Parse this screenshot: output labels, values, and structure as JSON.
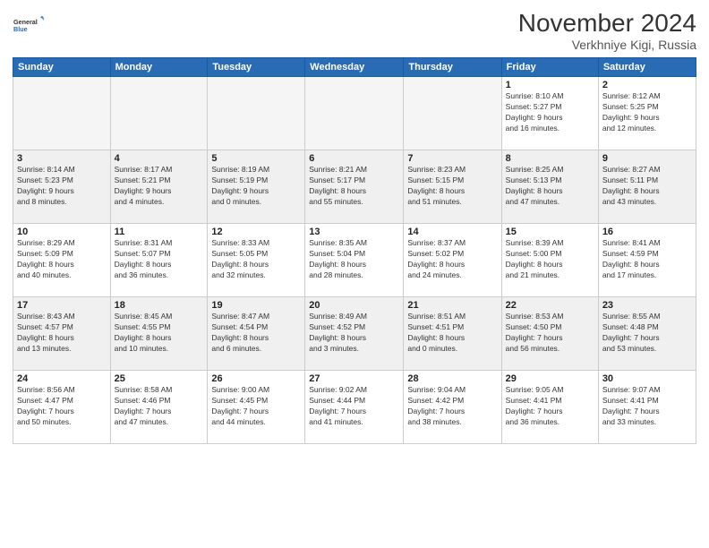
{
  "header": {
    "logo": {
      "general": "General",
      "blue": "Blue"
    },
    "title": "November 2024",
    "location": "Verkhniye Kigi, Russia"
  },
  "calendar": {
    "days_of_week": [
      "Sunday",
      "Monday",
      "Tuesday",
      "Wednesday",
      "Thursday",
      "Friday",
      "Saturday"
    ],
    "weeks": [
      [
        {
          "day": "",
          "info": ""
        },
        {
          "day": "",
          "info": ""
        },
        {
          "day": "",
          "info": ""
        },
        {
          "day": "",
          "info": ""
        },
        {
          "day": "",
          "info": ""
        },
        {
          "day": "1",
          "info": "Sunrise: 8:10 AM\nSunset: 5:27 PM\nDaylight: 9 hours\nand 16 minutes."
        },
        {
          "day": "2",
          "info": "Sunrise: 8:12 AM\nSunset: 5:25 PM\nDaylight: 9 hours\nand 12 minutes."
        }
      ],
      [
        {
          "day": "3",
          "info": "Sunrise: 8:14 AM\nSunset: 5:23 PM\nDaylight: 9 hours\nand 8 minutes."
        },
        {
          "day": "4",
          "info": "Sunrise: 8:17 AM\nSunset: 5:21 PM\nDaylight: 9 hours\nand 4 minutes."
        },
        {
          "day": "5",
          "info": "Sunrise: 8:19 AM\nSunset: 5:19 PM\nDaylight: 9 hours\nand 0 minutes."
        },
        {
          "day": "6",
          "info": "Sunrise: 8:21 AM\nSunset: 5:17 PM\nDaylight: 8 hours\nand 55 minutes."
        },
        {
          "day": "7",
          "info": "Sunrise: 8:23 AM\nSunset: 5:15 PM\nDaylight: 8 hours\nand 51 minutes."
        },
        {
          "day": "8",
          "info": "Sunrise: 8:25 AM\nSunset: 5:13 PM\nDaylight: 8 hours\nand 47 minutes."
        },
        {
          "day": "9",
          "info": "Sunrise: 8:27 AM\nSunset: 5:11 PM\nDaylight: 8 hours\nand 43 minutes."
        }
      ],
      [
        {
          "day": "10",
          "info": "Sunrise: 8:29 AM\nSunset: 5:09 PM\nDaylight: 8 hours\nand 40 minutes."
        },
        {
          "day": "11",
          "info": "Sunrise: 8:31 AM\nSunset: 5:07 PM\nDaylight: 8 hours\nand 36 minutes."
        },
        {
          "day": "12",
          "info": "Sunrise: 8:33 AM\nSunset: 5:05 PM\nDaylight: 8 hours\nand 32 minutes."
        },
        {
          "day": "13",
          "info": "Sunrise: 8:35 AM\nSunset: 5:04 PM\nDaylight: 8 hours\nand 28 minutes."
        },
        {
          "day": "14",
          "info": "Sunrise: 8:37 AM\nSunset: 5:02 PM\nDaylight: 8 hours\nand 24 minutes."
        },
        {
          "day": "15",
          "info": "Sunrise: 8:39 AM\nSunset: 5:00 PM\nDaylight: 8 hours\nand 21 minutes."
        },
        {
          "day": "16",
          "info": "Sunrise: 8:41 AM\nSunset: 4:59 PM\nDaylight: 8 hours\nand 17 minutes."
        }
      ],
      [
        {
          "day": "17",
          "info": "Sunrise: 8:43 AM\nSunset: 4:57 PM\nDaylight: 8 hours\nand 13 minutes."
        },
        {
          "day": "18",
          "info": "Sunrise: 8:45 AM\nSunset: 4:55 PM\nDaylight: 8 hours\nand 10 minutes."
        },
        {
          "day": "19",
          "info": "Sunrise: 8:47 AM\nSunset: 4:54 PM\nDaylight: 8 hours\nand 6 minutes."
        },
        {
          "day": "20",
          "info": "Sunrise: 8:49 AM\nSunset: 4:52 PM\nDaylight: 8 hours\nand 3 minutes."
        },
        {
          "day": "21",
          "info": "Sunrise: 8:51 AM\nSunset: 4:51 PM\nDaylight: 8 hours\nand 0 minutes."
        },
        {
          "day": "22",
          "info": "Sunrise: 8:53 AM\nSunset: 4:50 PM\nDaylight: 7 hours\nand 56 minutes."
        },
        {
          "day": "23",
          "info": "Sunrise: 8:55 AM\nSunset: 4:48 PM\nDaylight: 7 hours\nand 53 minutes."
        }
      ],
      [
        {
          "day": "24",
          "info": "Sunrise: 8:56 AM\nSunset: 4:47 PM\nDaylight: 7 hours\nand 50 minutes."
        },
        {
          "day": "25",
          "info": "Sunrise: 8:58 AM\nSunset: 4:46 PM\nDaylight: 7 hours\nand 47 minutes."
        },
        {
          "day": "26",
          "info": "Sunrise: 9:00 AM\nSunset: 4:45 PM\nDaylight: 7 hours\nand 44 minutes."
        },
        {
          "day": "27",
          "info": "Sunrise: 9:02 AM\nSunset: 4:44 PM\nDaylight: 7 hours\nand 41 minutes."
        },
        {
          "day": "28",
          "info": "Sunrise: 9:04 AM\nSunset: 4:42 PM\nDaylight: 7 hours\nand 38 minutes."
        },
        {
          "day": "29",
          "info": "Sunrise: 9:05 AM\nSunset: 4:41 PM\nDaylight: 7 hours\nand 36 minutes."
        },
        {
          "day": "30",
          "info": "Sunrise: 9:07 AM\nSunset: 4:41 PM\nDaylight: 7 hours\nand 33 minutes."
        }
      ]
    ]
  }
}
